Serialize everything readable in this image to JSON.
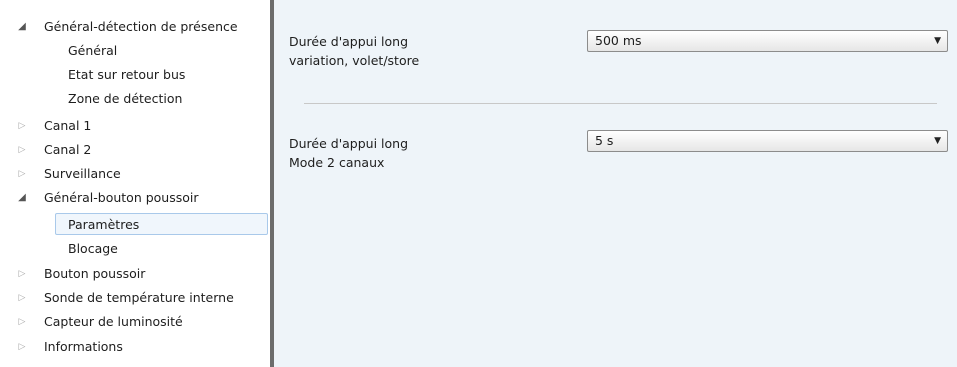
{
  "tree": {
    "items": [
      {
        "label": "Général-détection de présence",
        "arrow": "◢"
      },
      {
        "label": "Général"
      },
      {
        "label": "Etat sur retour bus"
      },
      {
        "label": "Zone de détection"
      },
      {
        "label": "Canal 1",
        "arrow": "▷"
      },
      {
        "label": "Canal 2",
        "arrow": "▷"
      },
      {
        "label": "Surveillance",
        "arrow": "▷"
      },
      {
        "label": "Général-bouton poussoir",
        "arrow": "◢"
      },
      {
        "label": "Paramètres"
      },
      {
        "label": "Blocage"
      },
      {
        "label": "Bouton poussoir",
        "arrow": "▷"
      },
      {
        "label": "Sonde de température interne",
        "arrow": "▷"
      },
      {
        "label": "Capteur de luminosité",
        "arrow": "▷"
      },
      {
        "label": "Informations",
        "arrow": "▷"
      }
    ]
  },
  "params": [
    {
      "label_line1": "Durée d'appui long",
      "label_line2": "variation, volet/store",
      "value": "500 ms"
    },
    {
      "label_line1": "Durée d'appui long",
      "label_line2": "Mode 2 canaux",
      "value": "5 s"
    }
  ],
  "dropdown_arrow": "▼",
  "colors": {
    "content_background": "#eef4f9",
    "selected_item_border": "#a9c9ea",
    "sidebar_divider": "#6c6c6c"
  }
}
